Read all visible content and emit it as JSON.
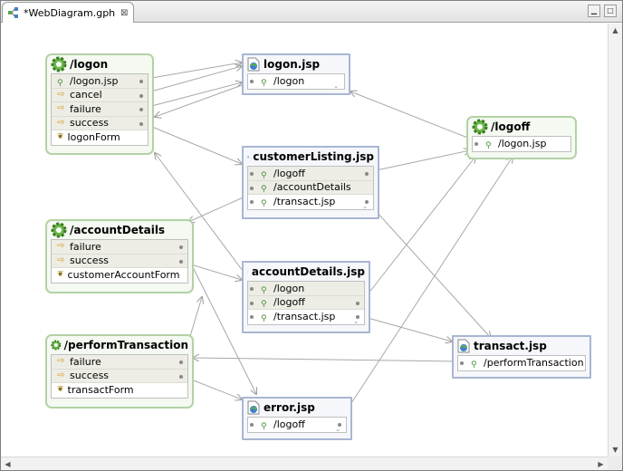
{
  "editor": {
    "tab_title": "*WebDiagram.gph",
    "tab_close": "⊠",
    "minimize": "▁",
    "maximize": "□"
  },
  "actions": {
    "logon": {
      "title": "/logon",
      "rows": [
        "/logon.jsp",
        "cancel",
        "failure",
        "success",
        "logonForm"
      ]
    },
    "accountDetails": {
      "title": "/accountDetails",
      "rows": [
        "failure",
        "success",
        "customerAccountForm"
      ]
    },
    "performTransaction": {
      "title": "/performTransaction",
      "rows": [
        "failure",
        "success",
        "transactForm"
      ]
    },
    "logoff": {
      "title": "/logoff",
      "rows": [
        "/logon.jsp"
      ]
    }
  },
  "pages": {
    "logon_jsp": {
      "title": "logon.jsp",
      "rows": [
        "/logon"
      ]
    },
    "customerListing_jsp": {
      "title": "customerListing.jsp",
      "rows": [
        "/logoff",
        "/accountDetails",
        "/transact.jsp"
      ]
    },
    "accountDetails_jsp": {
      "title": "accountDetails.jsp",
      "rows": [
        "/logon",
        "/logoff",
        "/transact.jsp"
      ]
    },
    "transact_jsp": {
      "title": "transact.jsp",
      "rows": [
        "/performTransaction"
      ]
    },
    "error_jsp": {
      "title": "error.jsp",
      "rows": [
        "/logoff"
      ]
    }
  },
  "icons": {
    "action": "gear-icon",
    "page": "web-page-icon",
    "forward": "forward-arrow-icon",
    "link": "link-icon",
    "form_bean": "form-bean-icon"
  },
  "colors": {
    "action_border": "#b2d2a4",
    "page_border": "#a9b6d2",
    "connector": "#a8a8a8"
  }
}
